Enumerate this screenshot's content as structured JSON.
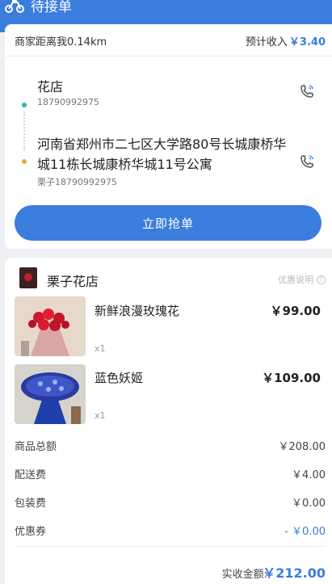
{
  "header": {
    "title": "待接单",
    "icon": "bike-icon"
  },
  "order": {
    "distance_text": "商家距离我0.14km",
    "income_label": "预计收入",
    "income_amount": "￥3.40",
    "pickup": {
      "name": "花店",
      "phone": "18790992975"
    },
    "delivery": {
      "address": "河南省郑州市二七区大学路80号长城康桥华城11栋长城康桥华城11号公寓",
      "recipient": "栗子18790992975"
    },
    "grab_button": "立即抢单"
  },
  "store": {
    "name": "栗子花店",
    "promo_link": "优惠说明",
    "products": [
      {
        "name": "新鲜浪漫玫瑰花",
        "price": "￥99.00",
        "qty": "x1"
      },
      {
        "name": "蓝色妖姬",
        "price": "￥109.00",
        "qty": "x1"
      }
    ],
    "fees": [
      {
        "label": "商品总额",
        "value": "￥208.00"
      },
      {
        "label": "配送费",
        "value": "￥4.00"
      },
      {
        "label": "包装费",
        "value": "￥0.00"
      },
      {
        "label": "优惠券",
        "value": "- ￥0.00"
      }
    ],
    "total_label": "实收金额:",
    "total_amount": "￥212.00"
  },
  "colors": {
    "accent": "#3b7ddd",
    "dot_pickup": "#2bb3a7",
    "dot_delivery": "#f0a340"
  }
}
